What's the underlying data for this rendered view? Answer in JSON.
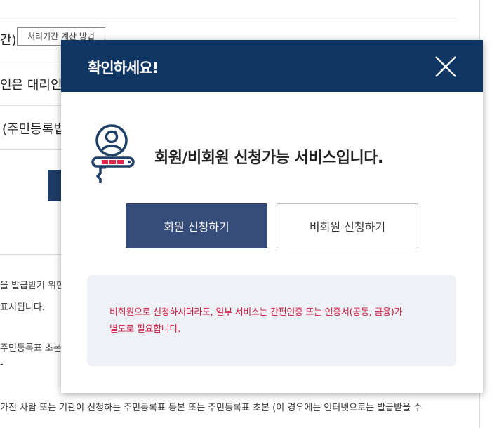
{
  "background": {
    "heading_fragment": "간)",
    "calc_button_label": "처리기간 계산 방법",
    "proxy_text_fragment": "인은 대리인",
    "resident_law_fragment": "(주민등록법",
    "issue_fragment_1": "을 발급받기 위한",
    "issue_fragment_2": "표시됩니다.",
    "abstract_fragment": "주민등록표 초본",
    "bullet_fragment": "-",
    "bottom_line": "가진 사람 또는 기관이 신청하는 주민등록표 등본 또는 주민등록표 초본 (이 경우에는 인터넷으로는 발급받을 수"
  },
  "modal": {
    "title": "확인하세요!",
    "close_icon": "close-icon",
    "service_icon": "user-certificate-icon",
    "headline": "회원/비회원 신청가능 서비스입니다.",
    "member_button": "회원 신청하기",
    "nonmember_button": "비회원 신청하기",
    "notice_line_1": "비회원으로 신청하시더라도, 일부 서비스는 간편인증 또는 인증서(공동, 금융)가",
    "notice_line_2": "별도로 필요합니다.",
    "colors": {
      "header": "#0f3563",
      "member_button": "#364c7b",
      "notice_text": "#d11a3c",
      "notice_background": "#eef2f7"
    }
  }
}
